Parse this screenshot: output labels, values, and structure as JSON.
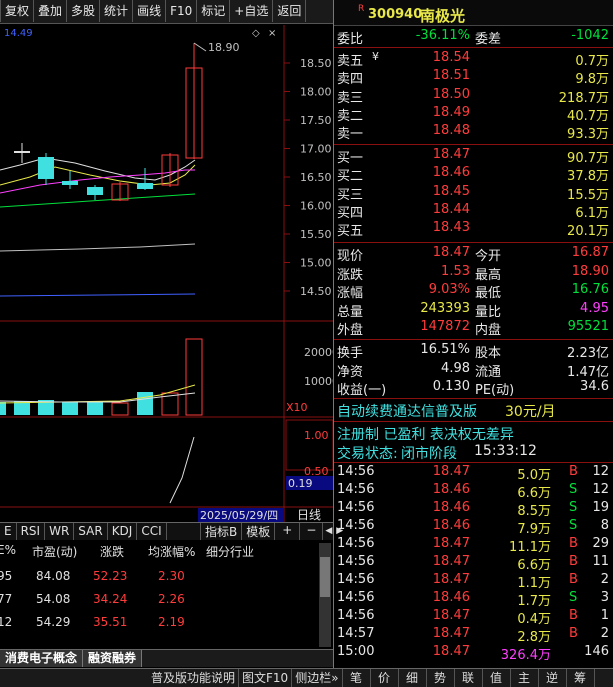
{
  "toolbar": [
    "复权",
    "叠加",
    "多股",
    "统计",
    "画线",
    "F10",
    "标记",
    "+自选",
    "返回"
  ],
  "chart": {
    "max_price": "18.90",
    "y_ticks": [
      "18.50",
      "18.00",
      "17.50",
      "17.00",
      "16.50",
      "16.00",
      "15.50",
      "15.00",
      "14.50"
    ],
    "vol_ticks": [
      "20000",
      "10000"
    ],
    "vol_mult": "X10",
    "ind_ticks": [
      "1.00",
      "0.50"
    ],
    "ind_value": "0.19",
    "date": "2025/05/29/四",
    "period": "日线",
    "partial_top": "14.49"
  },
  "chart_data": {
    "type": "candlestick",
    "title": "",
    "y_ticks": [
      18.5,
      18.0,
      17.5,
      17.0,
      16.5,
      16.0,
      15.5,
      15.0,
      14.5
    ],
    "max_marker": 18.9,
    "volume_ticks": [
      20000,
      10000
    ],
    "indicator_ticks": [
      1.0,
      0.5
    ],
    "indicator_value": 0.19
  },
  "midtabs": [
    "E",
    "RSI",
    "WR",
    "SAR",
    "KDJ",
    "CCI"
  ],
  "mid_buttons": {
    "ind": "指标B",
    "tpl": "模板",
    "plus": "+",
    "minus": "−",
    "left": "◀",
    "right": "▶"
  },
  "table": {
    "headers": [
      "E%",
      "市盈(动)",
      "涨跌",
      "均涨幅%",
      "细分行业"
    ],
    "rows": [
      [
        "95",
        "84.08",
        "52.23",
        "2.30"
      ],
      [
        "77",
        "54.08",
        "34.24",
        "2.26"
      ],
      [
        "12",
        "54.29",
        "35.51",
        "2.19"
      ]
    ]
  },
  "bottomtabs": [
    "消费电子概念",
    "融资融券"
  ],
  "footer": [
    "普及版功能说明",
    "图文F10",
    "侧边栏»",
    "笔",
    "价",
    "细",
    "势",
    "联",
    "值",
    "主",
    "逆",
    "筹"
  ],
  "stock": {
    "code": "300940",
    "name": "南极光",
    "r": "R"
  },
  "wei": {
    "label1": "委比",
    "value1": "-36.11%",
    "label2": "委差",
    "value2": "-1042"
  },
  "sells": [
    {
      "l": "卖五",
      "p": "18.54",
      "v": "0.7万"
    },
    {
      "l": "卖四",
      "p": "18.51",
      "v": "9.8万"
    },
    {
      "l": "卖三",
      "p": "18.50",
      "v": "218.7万"
    },
    {
      "l": "卖二",
      "p": "18.49",
      "v": "40.7万"
    },
    {
      "l": "卖一",
      "p": "18.48",
      "v": "93.3万"
    }
  ],
  "buys": [
    {
      "l": "买一",
      "p": "18.47",
      "v": "90.7万"
    },
    {
      "l": "买二",
      "p": "18.46",
      "v": "37.8万"
    },
    {
      "l": "买三",
      "p": "18.45",
      "v": "15.5万"
    },
    {
      "l": "买四",
      "p": "18.44",
      "v": "6.1万"
    },
    {
      "l": "买五",
      "p": "18.43",
      "v": "20.1万"
    }
  ],
  "quote": [
    {
      "l1": "现价",
      "v1": "18.47",
      "l2": "今开",
      "v2": "16.87"
    },
    {
      "l1": "涨跌",
      "v1": "1.53",
      "l2": "最高",
      "v2": "18.90"
    },
    {
      "l1": "涨幅",
      "v1": "9.03%",
      "l2": "最低",
      "v2": "16.76"
    },
    {
      "l1": "总量",
      "v1": "243393",
      "l2": "量比",
      "v2": "4.95"
    },
    {
      "l1": "外盘",
      "v1": "147872",
      "l2": "内盘",
      "v2": "95521"
    }
  ],
  "stats": [
    {
      "l1": "换手",
      "v1": "16.51%",
      "l2": "股本",
      "v2": "2.23亿"
    },
    {
      "l1": "净资",
      "v1": "4.98",
      "l2": "流通",
      "v2": "1.47亿"
    },
    {
      "l1": "收益(一)",
      "v1": "0.130",
      "l2": "PE(动)",
      "v2": "34.6"
    }
  ],
  "promo": {
    "text": "自动续费通达信普及版",
    "price": "30元/月"
  },
  "reg": "注册制 已盈利 表决权无差异",
  "status": {
    "label": "交易状态:",
    "state": "闭市阶段",
    "time": "15:33:12"
  },
  "ticks": [
    {
      "t": "14:56",
      "p": "18.47",
      "v": "5.0万",
      "s": "B",
      "n": "12"
    },
    {
      "t": "14:56",
      "p": "18.46",
      "v": "6.6万",
      "s": "S",
      "n": "12"
    },
    {
      "t": "14:56",
      "p": "18.46",
      "v": "8.5万",
      "s": "S",
      "n": "19"
    },
    {
      "t": "14:56",
      "p": "18.46",
      "v": "7.9万",
      "s": "S",
      "n": "8"
    },
    {
      "t": "14:56",
      "p": "18.47",
      "v": "11.1万",
      "s": "B",
      "n": "29"
    },
    {
      "t": "14:56",
      "p": "18.47",
      "v": "6.6万",
      "s": "B",
      "n": "11"
    },
    {
      "t": "14:56",
      "p": "18.47",
      "v": "1.1万",
      "s": "B",
      "n": "2"
    },
    {
      "t": "14:56",
      "p": "18.46",
      "v": "1.7万",
      "s": "S",
      "n": "3"
    },
    {
      "t": "14:56",
      "p": "18.47",
      "v": "0.4万",
      "s": "B",
      "n": "1"
    },
    {
      "t": "14:57",
      "p": "18.47",
      "v": "2.8万",
      "s": "B",
      "n": "2"
    },
    {
      "t": "15:00",
      "p": "18.47",
      "v": "326.4万",
      "s": "",
      "n": "146"
    }
  ]
}
